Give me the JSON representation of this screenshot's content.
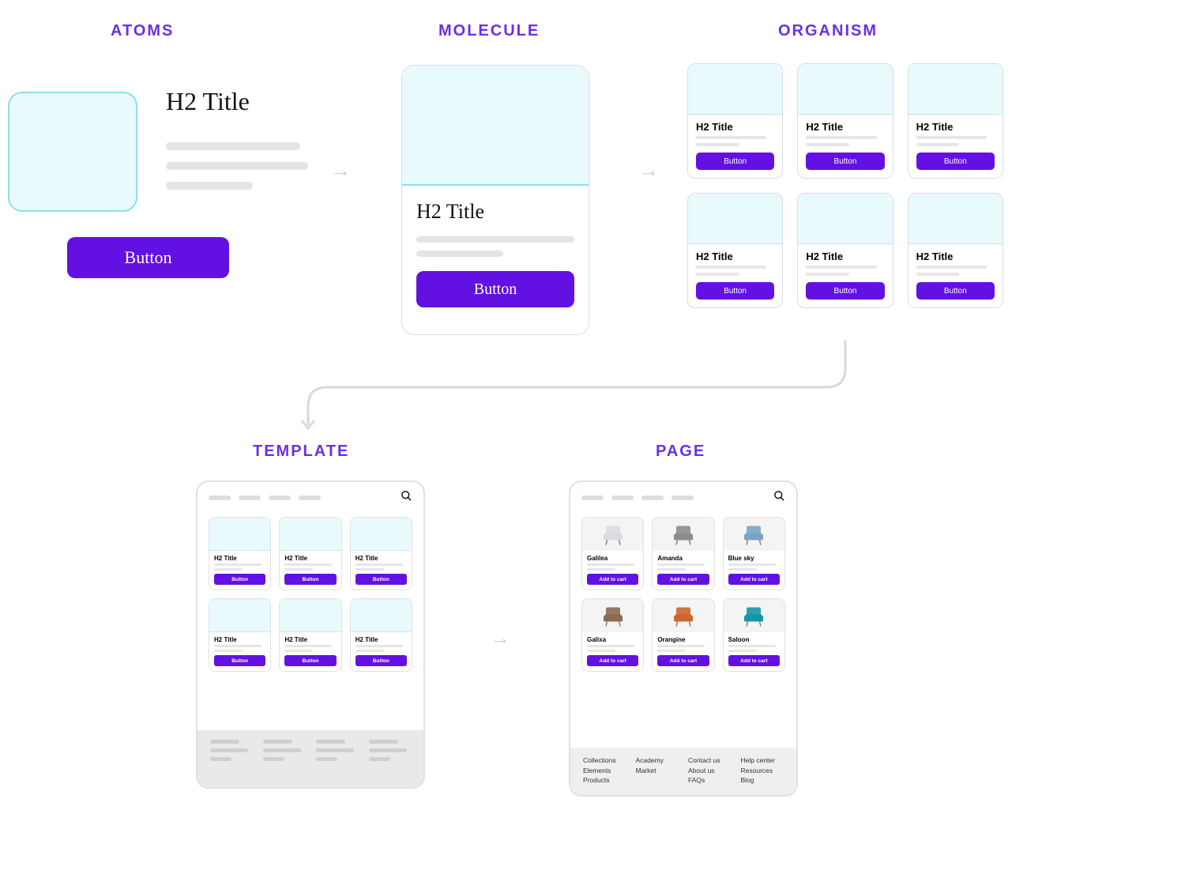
{
  "labels": {
    "atoms": "ATOMS",
    "molecule": "MOLECULE",
    "organism": "ORGANISM",
    "template": "TEMPLATE",
    "page": "PAGE"
  },
  "atom": {
    "title": "H2 Title",
    "button": "Button"
  },
  "molecule": {
    "title": "H2 Title",
    "button": "Button"
  },
  "organism": {
    "card_title": "H2 Title",
    "card_button": "Button"
  },
  "template": {
    "card_title": "H2 Title",
    "card_button": "Button"
  },
  "page": {
    "products": [
      {
        "name": "Galilea",
        "cta": "Add to cart",
        "color": "#d9dcdf"
      },
      {
        "name": "Amanda",
        "cta": "Add to cart",
        "color": "#8a8c8e"
      },
      {
        "name": "Blue sky",
        "cta": "Add to cart",
        "color": "#7ba4c4"
      },
      {
        "name": "Galixa",
        "cta": "Add to cart",
        "color": "#8b6a53"
      },
      {
        "name": "Orangine",
        "cta": "Add to cart",
        "color": "#d0642f"
      },
      {
        "name": "Saloon",
        "cta": "Add to cart",
        "color": "#1596a6"
      }
    ],
    "footer": {
      "col1": [
        "Collections",
        "Elements",
        "Products"
      ],
      "col2": [
        "Academy",
        "Market"
      ],
      "col3": [
        "Contact us",
        "About us",
        "FAQs"
      ],
      "col4": [
        "Help center",
        "Resources",
        "Blog"
      ]
    }
  }
}
